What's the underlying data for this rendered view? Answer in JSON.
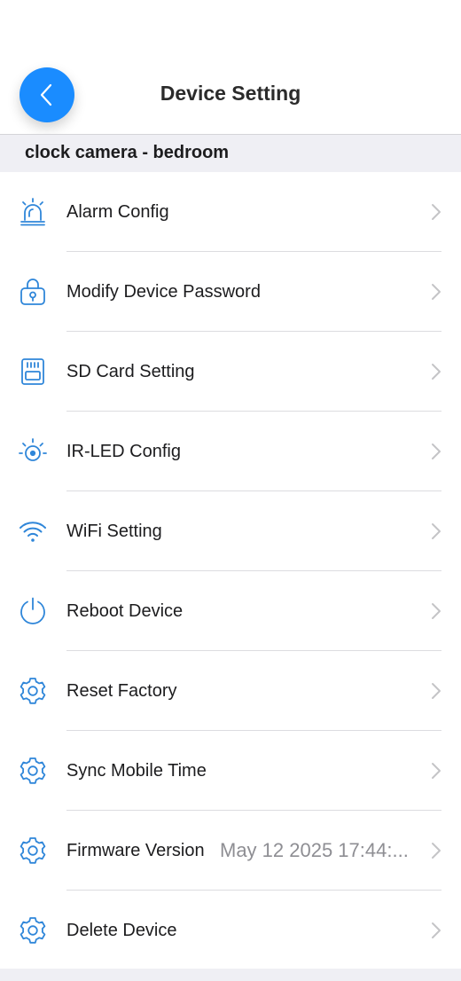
{
  "header": {
    "title": "Device Setting",
    "back_icon": "chevron-left-icon"
  },
  "device": {
    "name": "clock camera - bedroom"
  },
  "settings": [
    {
      "label": "Alarm Config",
      "icon": "alarm-light-icon"
    },
    {
      "label": "Modify Device Password",
      "icon": "lock-icon"
    },
    {
      "label": "SD Card Setting",
      "icon": "sd-card-icon"
    },
    {
      "label": "IR-LED Config",
      "icon": "ir-led-icon"
    },
    {
      "label": "WiFi Setting",
      "icon": "wifi-icon"
    },
    {
      "label": "Reboot Device",
      "icon": "power-icon"
    },
    {
      "label": "Reset Factory",
      "icon": "gear-icon"
    },
    {
      "label": "Sync Mobile Time",
      "icon": "gear-icon"
    },
    {
      "label": "Firmware Version",
      "icon": "gear-icon",
      "value": "May 12 2025 17:44:..."
    },
    {
      "label": "Delete Device",
      "icon": "gear-icon"
    }
  ],
  "colors": {
    "accent": "#1a8cff",
    "icon_blue": "#2f86d9",
    "section_background": "#efeff4",
    "secondary_text": "#8e8e93",
    "chevron": "#c4c4c7"
  }
}
